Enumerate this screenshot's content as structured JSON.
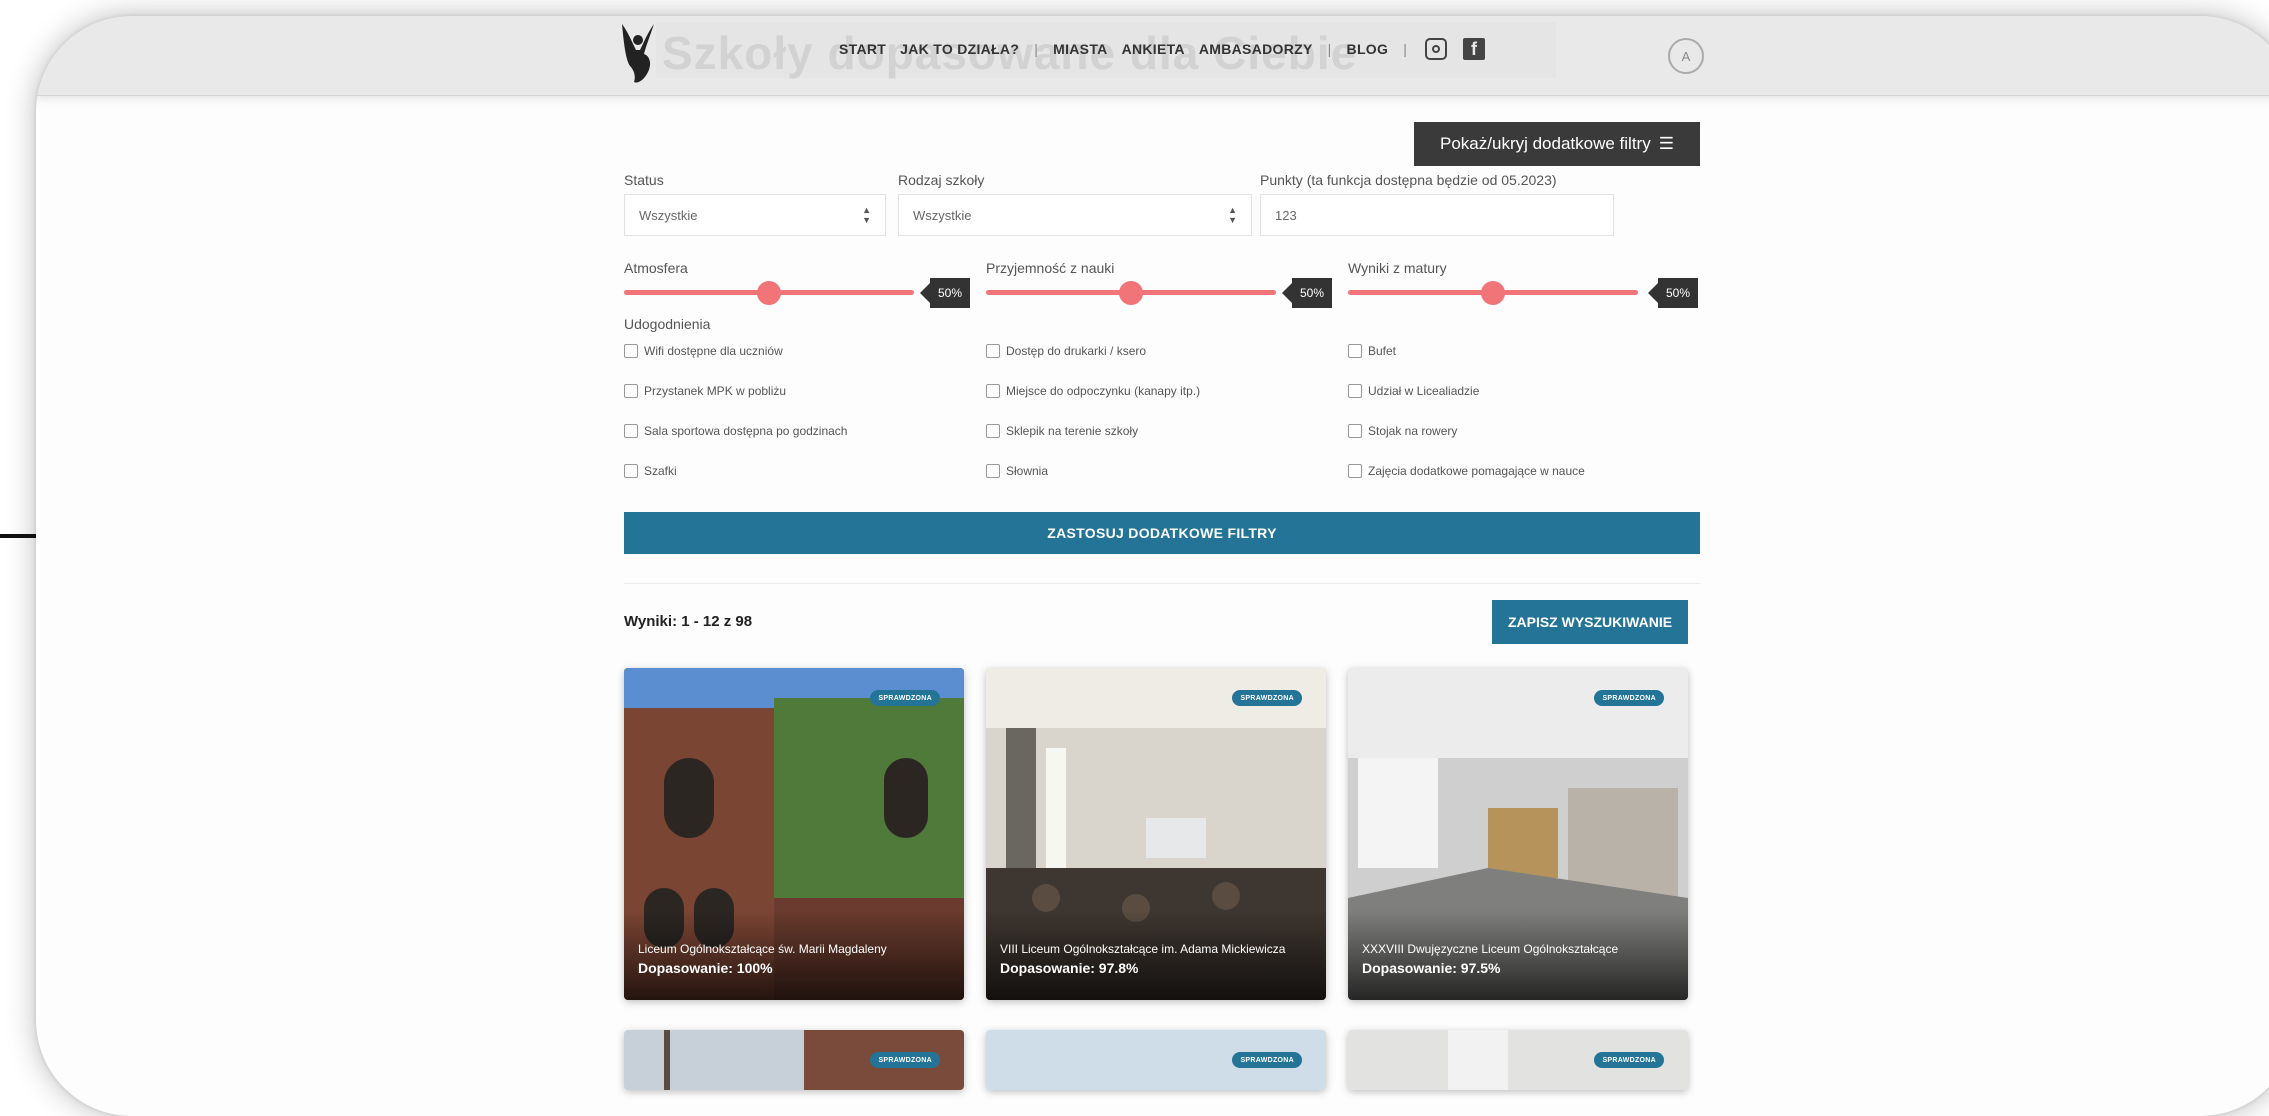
{
  "header": {
    "ghost_title": "Szkoły dopasowane dla Ciebie",
    "nav": [
      "START",
      "JAK TO DZIAŁA?",
      "MIASTA",
      "ANKIETA",
      "AMBASADORZY",
      "BLOG"
    ],
    "account_initial": "A",
    "icons": [
      "logo-icon",
      "instagram-icon",
      "facebook-icon",
      "account-icon"
    ]
  },
  "filters": {
    "toggle_label": "Pokaż/ukryj dodatkowe filtry",
    "status_label": "Status",
    "status_value": "Wszystkie",
    "type_label": "Rodzaj szkoły",
    "type_value": "Wszystkie",
    "points_label": "Punkty (ta funkcja dostępna będzie od 05.2023)",
    "points_value": "123",
    "sliders": [
      {
        "label": "Atmosfera",
        "percent": 50,
        "display": "50%"
      },
      {
        "label": "Przyjemność z nauki",
        "percent": 50,
        "display": "50%"
      },
      {
        "label": "Wyniki z matury",
        "percent": 50,
        "display": "50%"
      }
    ],
    "amenities_label": "Udogodnienia",
    "amenities": [
      [
        "Wifi dostępne dla uczniów",
        "Dostęp do drukarki / ksero",
        "Bufet"
      ],
      [
        "Przystanek MPK w pobliżu",
        "Miejsce do odpoczynku (kanapy itp.)",
        "Udział w Licealiadzie"
      ],
      [
        "Sala sportowa dostępna po godzinach",
        "Sklepik na terenie szkoły",
        "Stojak na rowery"
      ],
      [
        "Szafki",
        "Słownia",
        "Zajęcia dodatkowe pomagające w nauce"
      ]
    ],
    "apply_label": "ZASTOSUJ DODATKOWE FILTRY"
  },
  "results": {
    "summary": "Wyniki: 1 - 12 z 98",
    "save_label": "ZAPISZ WYSZUKIWANIE",
    "cards": [
      {
        "badge": "SPRAWDZONA",
        "name": "Liceum Ogólnokształcące św. Marii Magdaleny",
        "match": "Dopasowanie: 100%"
      },
      {
        "badge": "SPRAWDZONA",
        "name": "VIII Liceum Ogólnokształcące im. Adama Mickiewicza",
        "match": "Dopasowanie: 97.8%"
      },
      {
        "badge": "SPRAWDZONA",
        "name": "XXXVIII Dwujęzyczne Liceum Ogólnokształcące",
        "match": "Dopasowanie: 97.5%"
      },
      {
        "badge": "SPRAWDZONA"
      },
      {
        "badge": "SPRAWDZONA"
      },
      {
        "badge": "SPRAWDZONA"
      }
    ]
  },
  "colors": {
    "accent": "#237497",
    "slider": "#f07478",
    "dark": "#333333"
  }
}
